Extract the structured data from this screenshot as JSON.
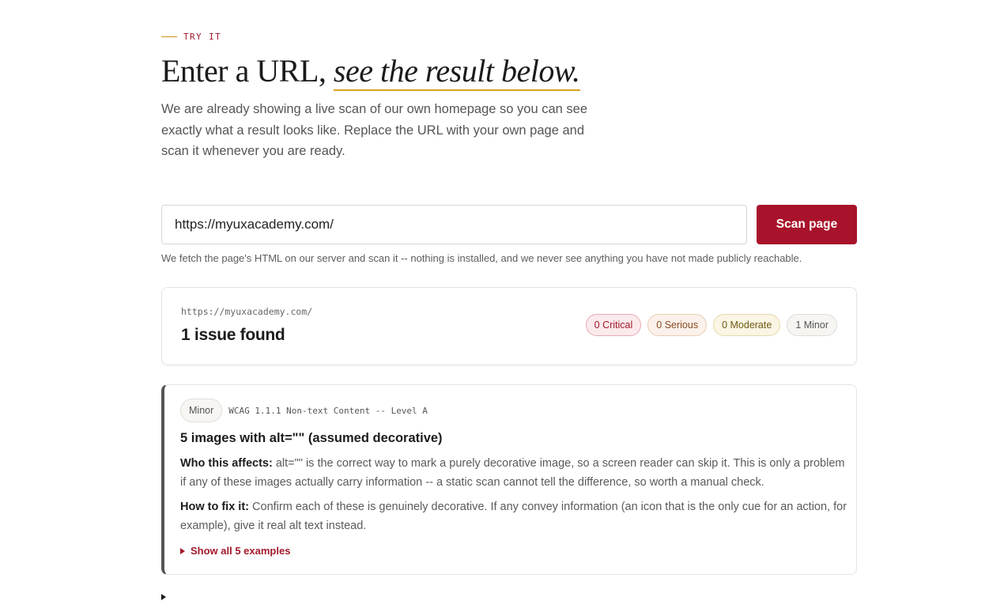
{
  "section": {
    "eyebrow": "TRY IT",
    "headline_plain": "Enter a URL,",
    "headline_emphasis": "see the result below.",
    "intro": "We are already showing a live scan of our own homepage so you can see exactly what a result looks like. Replace the URL with your own page and scan it whenever you are ready."
  },
  "scan_form": {
    "url_value": "https://myuxacademy.com/",
    "button_label": "Scan page",
    "note": "We fetch the page's HTML on our server and scan it -- nothing is installed, and we never see anything you have not made publicly reachable."
  },
  "summary": {
    "scanned_url": "https://myuxacademy.com/",
    "issue_count_text": "1 issue found",
    "badges": {
      "critical": "0 Critical",
      "serious": "0 Serious",
      "moderate": "0 Moderate",
      "minor": "1 Minor"
    }
  },
  "issue": {
    "severity": "Minor",
    "wcag": "WCAG 1.1.1 Non-text Content -- Level A",
    "title": "5 images with alt=\"\" (assumed decorative)",
    "who_label": "Who this affects:",
    "who_text": "alt=\"\" is the correct way to mark a purely decorative image, so a screen reader can skip it. This is only a problem if any of these images actually carry information -- a static scan cannot tell the difference, so worth a manual check.",
    "fix_label": "How to fix it:",
    "fix_text": "Confirm each of these is genuinely decorative. If any convey information (an icon that is the only cue for an action, for example), give it real alt text instead.",
    "show_examples": "Show all 5 examples"
  },
  "colors": {
    "accent": "#a8122a",
    "underline": "#d9a21c"
  }
}
